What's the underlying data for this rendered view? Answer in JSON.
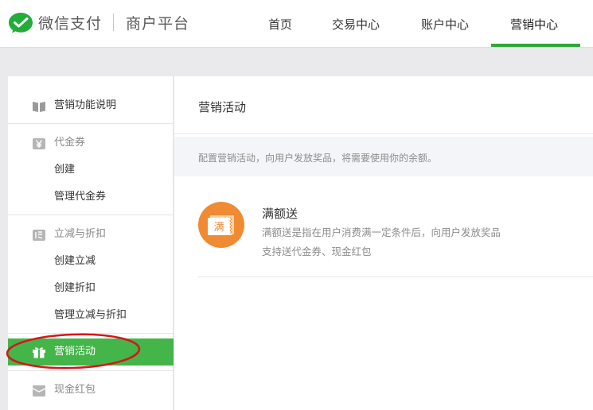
{
  "header": {
    "brand": "微信支付",
    "brand_sub": "商户平台",
    "nav": [
      {
        "label": "首页"
      },
      {
        "label": "交易中心"
      },
      {
        "label": "账户中心"
      },
      {
        "label": "营销中心",
        "active": true
      }
    ]
  },
  "sidebar": {
    "item_intro": "营销功能说明",
    "group_coupon": {
      "label": "代金券",
      "items": [
        "创建",
        "管理代金券"
      ]
    },
    "group_discount": {
      "label": "立减与折扣",
      "items": [
        "创建立减",
        "创建折扣",
        "管理立减与折扣"
      ]
    },
    "item_activity": "营销活动",
    "item_redpack": "现金红包"
  },
  "main": {
    "title": "营销活动",
    "notice": "配置营销活动，向用户发放奖品，将需要使用你的余额。",
    "card": {
      "icon_text": "满",
      "title": "满额送",
      "desc1": "满额送是指在用户消费满一定条件后，向用户发放奖品",
      "desc2": "支持送代金券、现金红包"
    }
  },
  "colors": {
    "accent_green": "#44b549",
    "nav_underline": "#2fa838",
    "card_orange": "#f08b33",
    "annotation_red": "#d9141b"
  },
  "icons": [
    "wechat-pay-logo-icon",
    "book-icon",
    "yen-icon",
    "discount-icon",
    "gift-icon",
    "redpack-icon",
    "coupon-ticket-icon"
  ]
}
